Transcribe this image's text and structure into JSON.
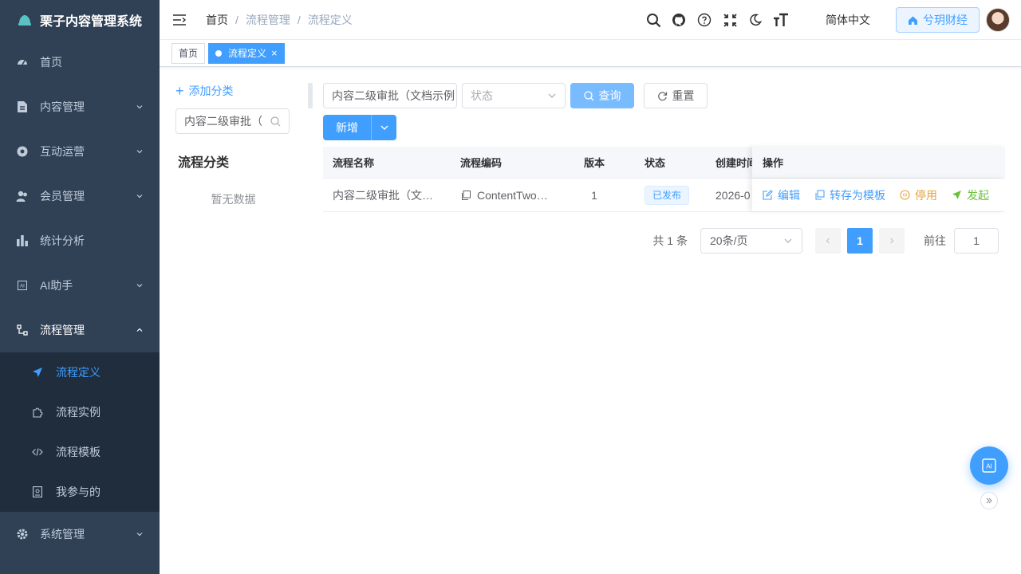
{
  "app": {
    "title": "栗子内容管理系统"
  },
  "sidebar": {
    "items": [
      {
        "label": "首页",
        "icon": "dashboard-icon"
      },
      {
        "label": "内容管理",
        "icon": "document-icon"
      },
      {
        "label": "互动运营",
        "icon": "target-icon"
      },
      {
        "label": "会员管理",
        "icon": "users-icon"
      },
      {
        "label": "统计分析",
        "icon": "bar-chart-icon"
      },
      {
        "label": "AI助手",
        "icon": "ai-icon"
      },
      {
        "label": "流程管理",
        "icon": "flow-icon"
      },
      {
        "label": "系统管理",
        "icon": "gear-icon"
      }
    ],
    "sub_items": [
      {
        "label": "流程定义",
        "icon": "send-icon"
      },
      {
        "label": "流程实例",
        "icon": "puzzle-icon"
      },
      {
        "label": "流程模板",
        "icon": "code-icon"
      },
      {
        "label": "我参与的",
        "icon": "id-card-icon"
      }
    ]
  },
  "navbar": {
    "breadcrumb": [
      "首页",
      "流程管理",
      "流程定义"
    ],
    "separator": "/",
    "language": "简体中文",
    "tenant": "兮玥财经"
  },
  "tags": {
    "home": "首页",
    "active": "流程定义",
    "close": "×"
  },
  "category": {
    "add_label": "添加分类",
    "search_value": "内容二级审批（",
    "title": "流程分类",
    "empty": "暂无数据"
  },
  "filters": {
    "name_value": "内容二级审批（文档示例",
    "status_placeholder": "状态",
    "query_label": "查询",
    "reset_label": "重置",
    "add_label": "新增"
  },
  "table": {
    "headers": {
      "name": "流程名称",
      "code": "流程编码",
      "version": "版本",
      "status": "状态",
      "created": "创建时间",
      "ops": "操作"
    },
    "rows": [
      {
        "name": "内容二级审批（文…",
        "code": "ContentTwo…",
        "version": "1",
        "status": "已发布",
        "created": "2026-0",
        "ops": {
          "edit": "编辑",
          "template": "转存为模板",
          "disable": "停用",
          "start": "发起"
        }
      }
    ]
  },
  "pagination": {
    "total": "共 1 条",
    "page_size": "20条/页",
    "current_page": "1",
    "goto_label": "前往",
    "goto_value": "1"
  },
  "colors": {
    "primary": "#409eff",
    "sidebar": "#304156",
    "submenu": "#1f2d3d",
    "warning": "#e6a23c",
    "success": "#67c23a"
  }
}
